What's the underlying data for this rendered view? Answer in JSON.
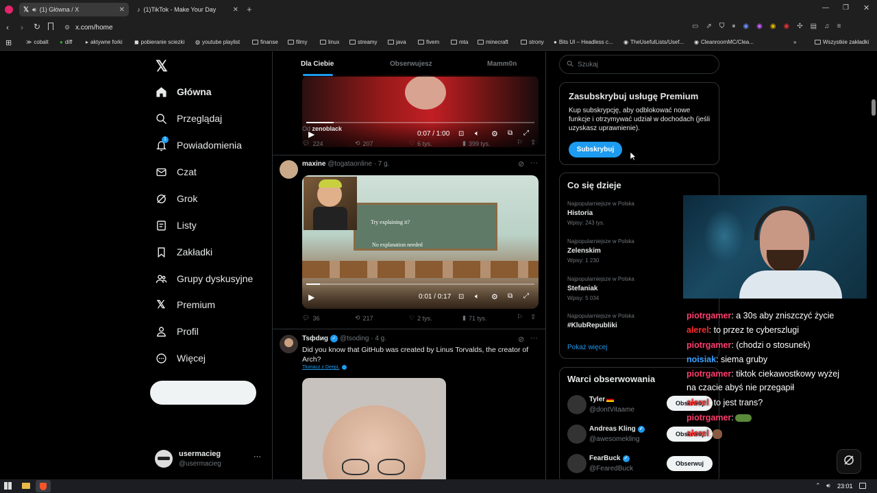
{
  "browser": {
    "tabs": [
      {
        "title": "(1) Główna / X",
        "active": true
      },
      {
        "title": "(1)TikTok - Make Your Day",
        "active": false
      }
    ],
    "url": "x.com/home",
    "bookmarks": [
      "cobalt",
      "diff",
      "aktywne forki",
      "pobieranie sciezki",
      "youtube playlist",
      "finanse",
      "filmy",
      "linux",
      "streamy",
      "java",
      "fivem",
      "mta",
      "minecraft",
      "strony",
      "Bits UI – Headless c...",
      "TheUsefulLists/Usef...",
      "CleanroomMC/Clea..."
    ],
    "bookmarks_all": "Wszystkie zakładki"
  },
  "nav": {
    "items": [
      {
        "label": "Główna",
        "icon": "home-icon"
      },
      {
        "label": "Przeglądaj",
        "icon": "search-icon"
      },
      {
        "label": "Powiadomienia",
        "icon": "bell-icon"
      },
      {
        "label": "Czat",
        "icon": "mail-icon"
      },
      {
        "label": "Grok",
        "icon": "grok-icon"
      },
      {
        "label": "Listy",
        "icon": "list-icon"
      },
      {
        "label": "Zakładki",
        "icon": "bookmark-icon"
      },
      {
        "label": "Grupy dyskusyjne",
        "icon": "people-icon"
      },
      {
        "label": "Premium",
        "icon": "x-logo-icon"
      },
      {
        "label": "Profil",
        "icon": "person-icon"
      },
      {
        "label": "Więcej",
        "icon": "more-circle-icon"
      }
    ],
    "notification_badge": "1",
    "account": {
      "name": "usermacieg",
      "handle": "@usermacieg"
    }
  },
  "feed": {
    "tabs": [
      "Dla Ciebie",
      "Obserwujesz",
      "Mamm0n"
    ],
    "post1": {
      "time": "0:07 / 1:00",
      "from_label": "Od",
      "from_user": "zenoblack",
      "stats": {
        "replies": "224",
        "reposts": "207",
        "likes": "6 tys.",
        "views": "399 tys."
      }
    },
    "post2": {
      "name": "maxine",
      "handle": "@togataonline · 7 g.",
      "video_text_1": "Try explaining it?",
      "video_text_2": "No explanation needed",
      "time": "0:01 / 0:17",
      "stats": {
        "replies": "36",
        "reposts": "217",
        "likes": "2 tys.",
        "views": "71 tys."
      }
    },
    "post3": {
      "name": "Tsфdиg",
      "handle": "@tsoding · 4 g.",
      "text": "Did you know that GitHub was created by Linus Torvalds, the creator of Arch?",
      "translate": "Tłumacz z DeepL"
    }
  },
  "right": {
    "search_placeholder": "Szukaj",
    "premium": {
      "title": "Zasubskrybuj usługę Premium",
      "body": "Kup subskrypcję, aby odblokować nowe funkcje i otrzymywać udział w dochodach (jeśli uzyskasz uprawnienie).",
      "button": "Subskrybuj"
    },
    "trends": {
      "title": "Co się dzieje",
      "items": [
        {
          "meta": "Najpopularniejsze w Polska",
          "name": "Historia",
          "count": "Wpisy: 243 tys."
        },
        {
          "meta": "Najpopularniejsze w Polska",
          "name": "Zelenskim",
          "count": "Wpisy: 1 230"
        },
        {
          "meta": "Najpopularniejsze w Polska",
          "name": "Stefaniak",
          "count": "Wpisy: 5 034"
        },
        {
          "meta": "Najpopularniejsze w Polska",
          "name": "#KlubRepubliki",
          "count": ""
        }
      ],
      "more": "Pokaż więcej"
    },
    "follow": {
      "title": "Warci obserwowania",
      "people": [
        {
          "name": "Tyler",
          "handle": "@dontVitaame",
          "button": "Obserwuj"
        },
        {
          "name": "Andreas Kling",
          "handle": "@awesomekling",
          "button": "Obserwuj"
        },
        {
          "name": "FearBuck",
          "handle": "@FearedBuck",
          "button": "Obserwuj"
        }
      ]
    }
  },
  "chat": [
    {
      "user": "piotrgamer",
      "color": "#ff3e6e",
      "text": ": a 30s aby zniszczyć życie"
    },
    {
      "user": "alerel",
      "color": "#ff2a2a",
      "text": ": to przez te cyberszlugi"
    },
    {
      "user": "piotrgamer",
      "color": "#ff3e6e",
      "text": ": (chodzi o stosunek)"
    },
    {
      "user": "noisiak",
      "color": "#3aa0ff",
      "text": ": siema gruby"
    },
    {
      "user": "piotrgamer",
      "color": "#ff3e6e",
      "text": ": tiktok ciekawostkowy wyżej"
    },
    {
      "user": "",
      "color": "#fff",
      "text": "na czacie abyś nie przegapił"
    },
    {
      "user": "alerel",
      "color": "#ff2a2a",
      "text": ": to jest trans?"
    },
    {
      "user": "piotrgamer",
      "color": "#ff3e6e",
      "text": ":"
    },
    {
      "user": "alerel",
      "color": "#ff2a2a",
      "text": ":"
    }
  ],
  "taskbar": {
    "time": "23:01"
  }
}
